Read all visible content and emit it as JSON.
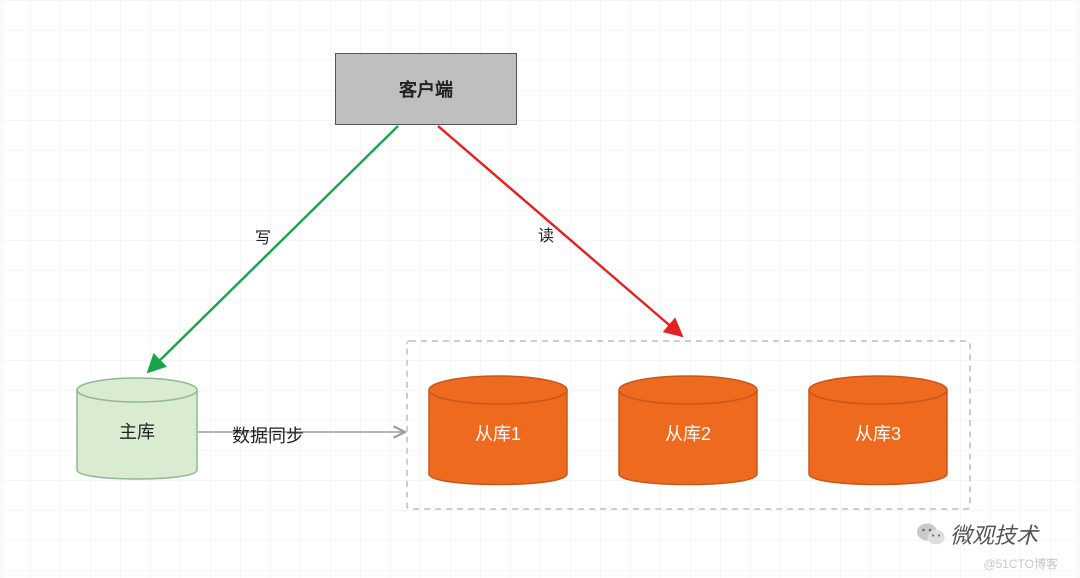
{
  "client": {
    "label": "客户端"
  },
  "master": {
    "label": "主库"
  },
  "slaves": [
    {
      "label": "从库1"
    },
    {
      "label": "从库2"
    },
    {
      "label": "从库3"
    }
  ],
  "edges": {
    "write": "写",
    "read": "读",
    "sync": "数据同步"
  },
  "brand": "微观技术",
  "watermark": "@51CTO博客",
  "colors": {
    "write": "#18a44a",
    "read": "#e62020",
    "sync": "#9c9c9c",
    "master_fill": "#d9ebd1",
    "master_stroke": "#8fb98f",
    "slave_fill": "#ed6a1f",
    "slave_stroke": "#c9561a",
    "client_fill": "#bfbfbf",
    "client_stroke": "#555"
  }
}
